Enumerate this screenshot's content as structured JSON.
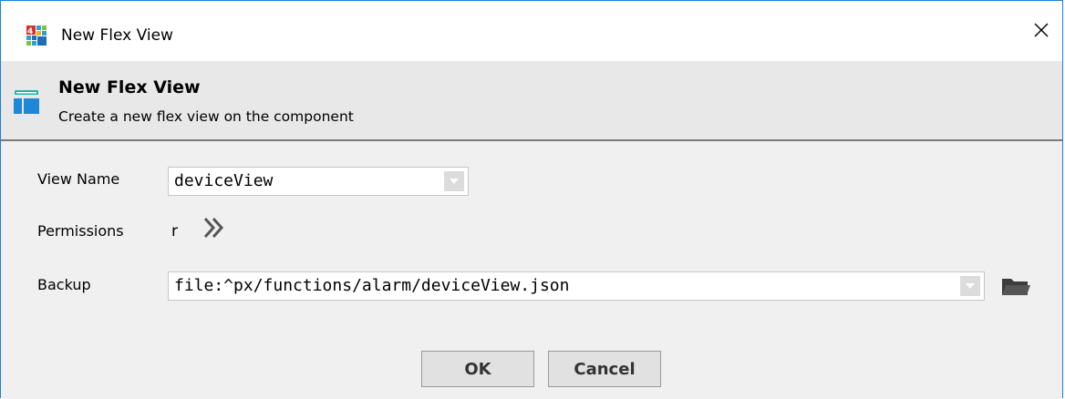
{
  "window": {
    "title": "New Flex View",
    "close_label": "✕"
  },
  "header": {
    "title": "New Flex View",
    "subtitle": "Create a new flex view on the component"
  },
  "form": {
    "view_name": {
      "label": "View Name",
      "value": "deviceView"
    },
    "permissions": {
      "label": "Permissions",
      "value": "r"
    },
    "backup": {
      "label": "Backup",
      "value": "file:^px/functions/alarm/deviceView.json"
    }
  },
  "buttons": {
    "ok": "OK",
    "cancel": "Cancel"
  },
  "icons": {
    "app": "niagara-app-icon",
    "header": "flex-view-icon",
    "permissions": "double-chevron-right-icon",
    "browse": "folder-icon",
    "dropdown": "chevron-down-icon"
  },
  "colors": {
    "window_border": "#1883d7",
    "header_icon_teal": "#1fb5a5",
    "header_icon_blue": "#1e88d6"
  }
}
